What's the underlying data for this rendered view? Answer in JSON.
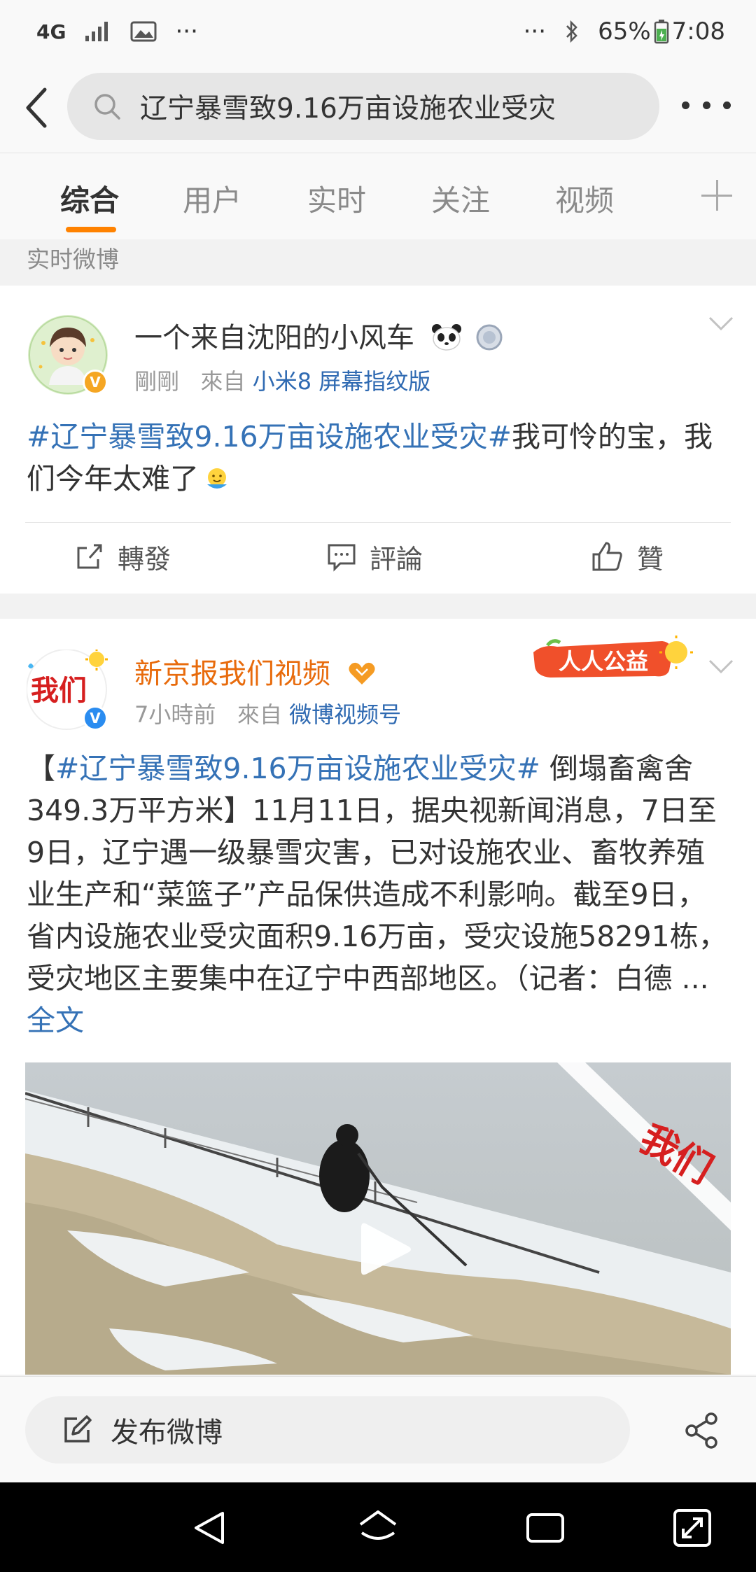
{
  "status_bar": {
    "network": "4G",
    "battery": "65%",
    "time": "7:08",
    "more_left": "···",
    "more_right": "···"
  },
  "search": {
    "query": "辽宁暴雪致9.16万亩设施农业受灾"
  },
  "tabs": [
    "综合",
    "用户",
    "实时",
    "关注",
    "视频"
  ],
  "active_tab": "综合",
  "section_label": "实时微博",
  "posts": [
    {
      "username": "一个来自沈阳的小风车",
      "time": "剛剛",
      "from_label": "來自",
      "source": "小米8 屏幕指纹版",
      "topic": "#辽宁暴雪致9.16万亩设施农业受灾#",
      "text": "我可怜的宝，我们今年太难了",
      "actions": {
        "repost": "轉發",
        "comment": "評論",
        "like": "贊"
      }
    },
    {
      "username": "新京报我们视频",
      "time": "7小時前",
      "from_label": "來自",
      "source": "微博视频号",
      "badge": "人人公益",
      "avatar_text": "我们",
      "text_open": "【",
      "topic": "#辽宁暴雪致9.16万亩设施农业受灾#",
      "text": " 倒塌畜禽舍349.3万平方米】11月11日，据央视新闻消息，7日至9日，辽宁遇一级暴雪灾害，已对设施农业、畜牧养殖业生产和“菜篮子”产品保供造成不利影响。截至9日，省内设施农业受灾面积9.16万亩，受灾设施58291栋，受灾地区主要集中在辽宁中西部地区。（记者：白德 ... ",
      "more": "全文",
      "video_watermark": "我们"
    }
  ],
  "compose": {
    "label": "发布微博"
  },
  "colors": {
    "accent": "#ff8200",
    "link": "#3572b6",
    "username_orange": "#e86b0c"
  }
}
